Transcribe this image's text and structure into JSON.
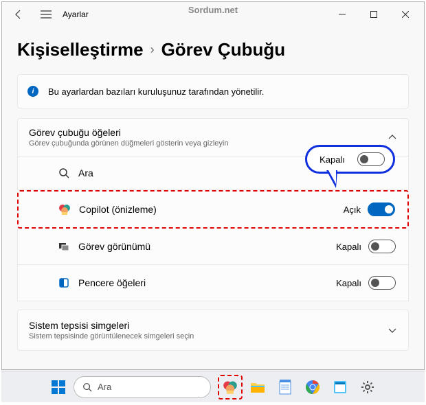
{
  "watermark": "Sordum.net",
  "app_title": "Ayarlar",
  "breadcrumb": {
    "parent": "Kişiselleştirme",
    "sep": "›",
    "current": "Görev Çubuğu"
  },
  "banner": "Bu ayarlardan bazıları kuruluşunuz tarafından yönetilir.",
  "section1": {
    "title": "Görev çubuğu öğeleri",
    "sub": "Görev çubuğunda görünen düğmeleri gösterin veya gizleyin"
  },
  "rows": {
    "search": {
      "label": "Ara",
      "state": ""
    },
    "copilot": {
      "label": "Copilot (önizleme)",
      "state": "Açık"
    },
    "taskview": {
      "label": "Görev görünümü",
      "state": "Kapalı"
    },
    "widgets": {
      "label": "Pencere öğeleri",
      "state": "Kapalı"
    }
  },
  "callout": {
    "state": "Kapalı"
  },
  "section2": {
    "title": "Sistem tepsisi simgeleri",
    "sub": "Sistem tepsisinde görüntülenecek simgeleri seçin"
  },
  "taskbar": {
    "search": "Ara"
  }
}
